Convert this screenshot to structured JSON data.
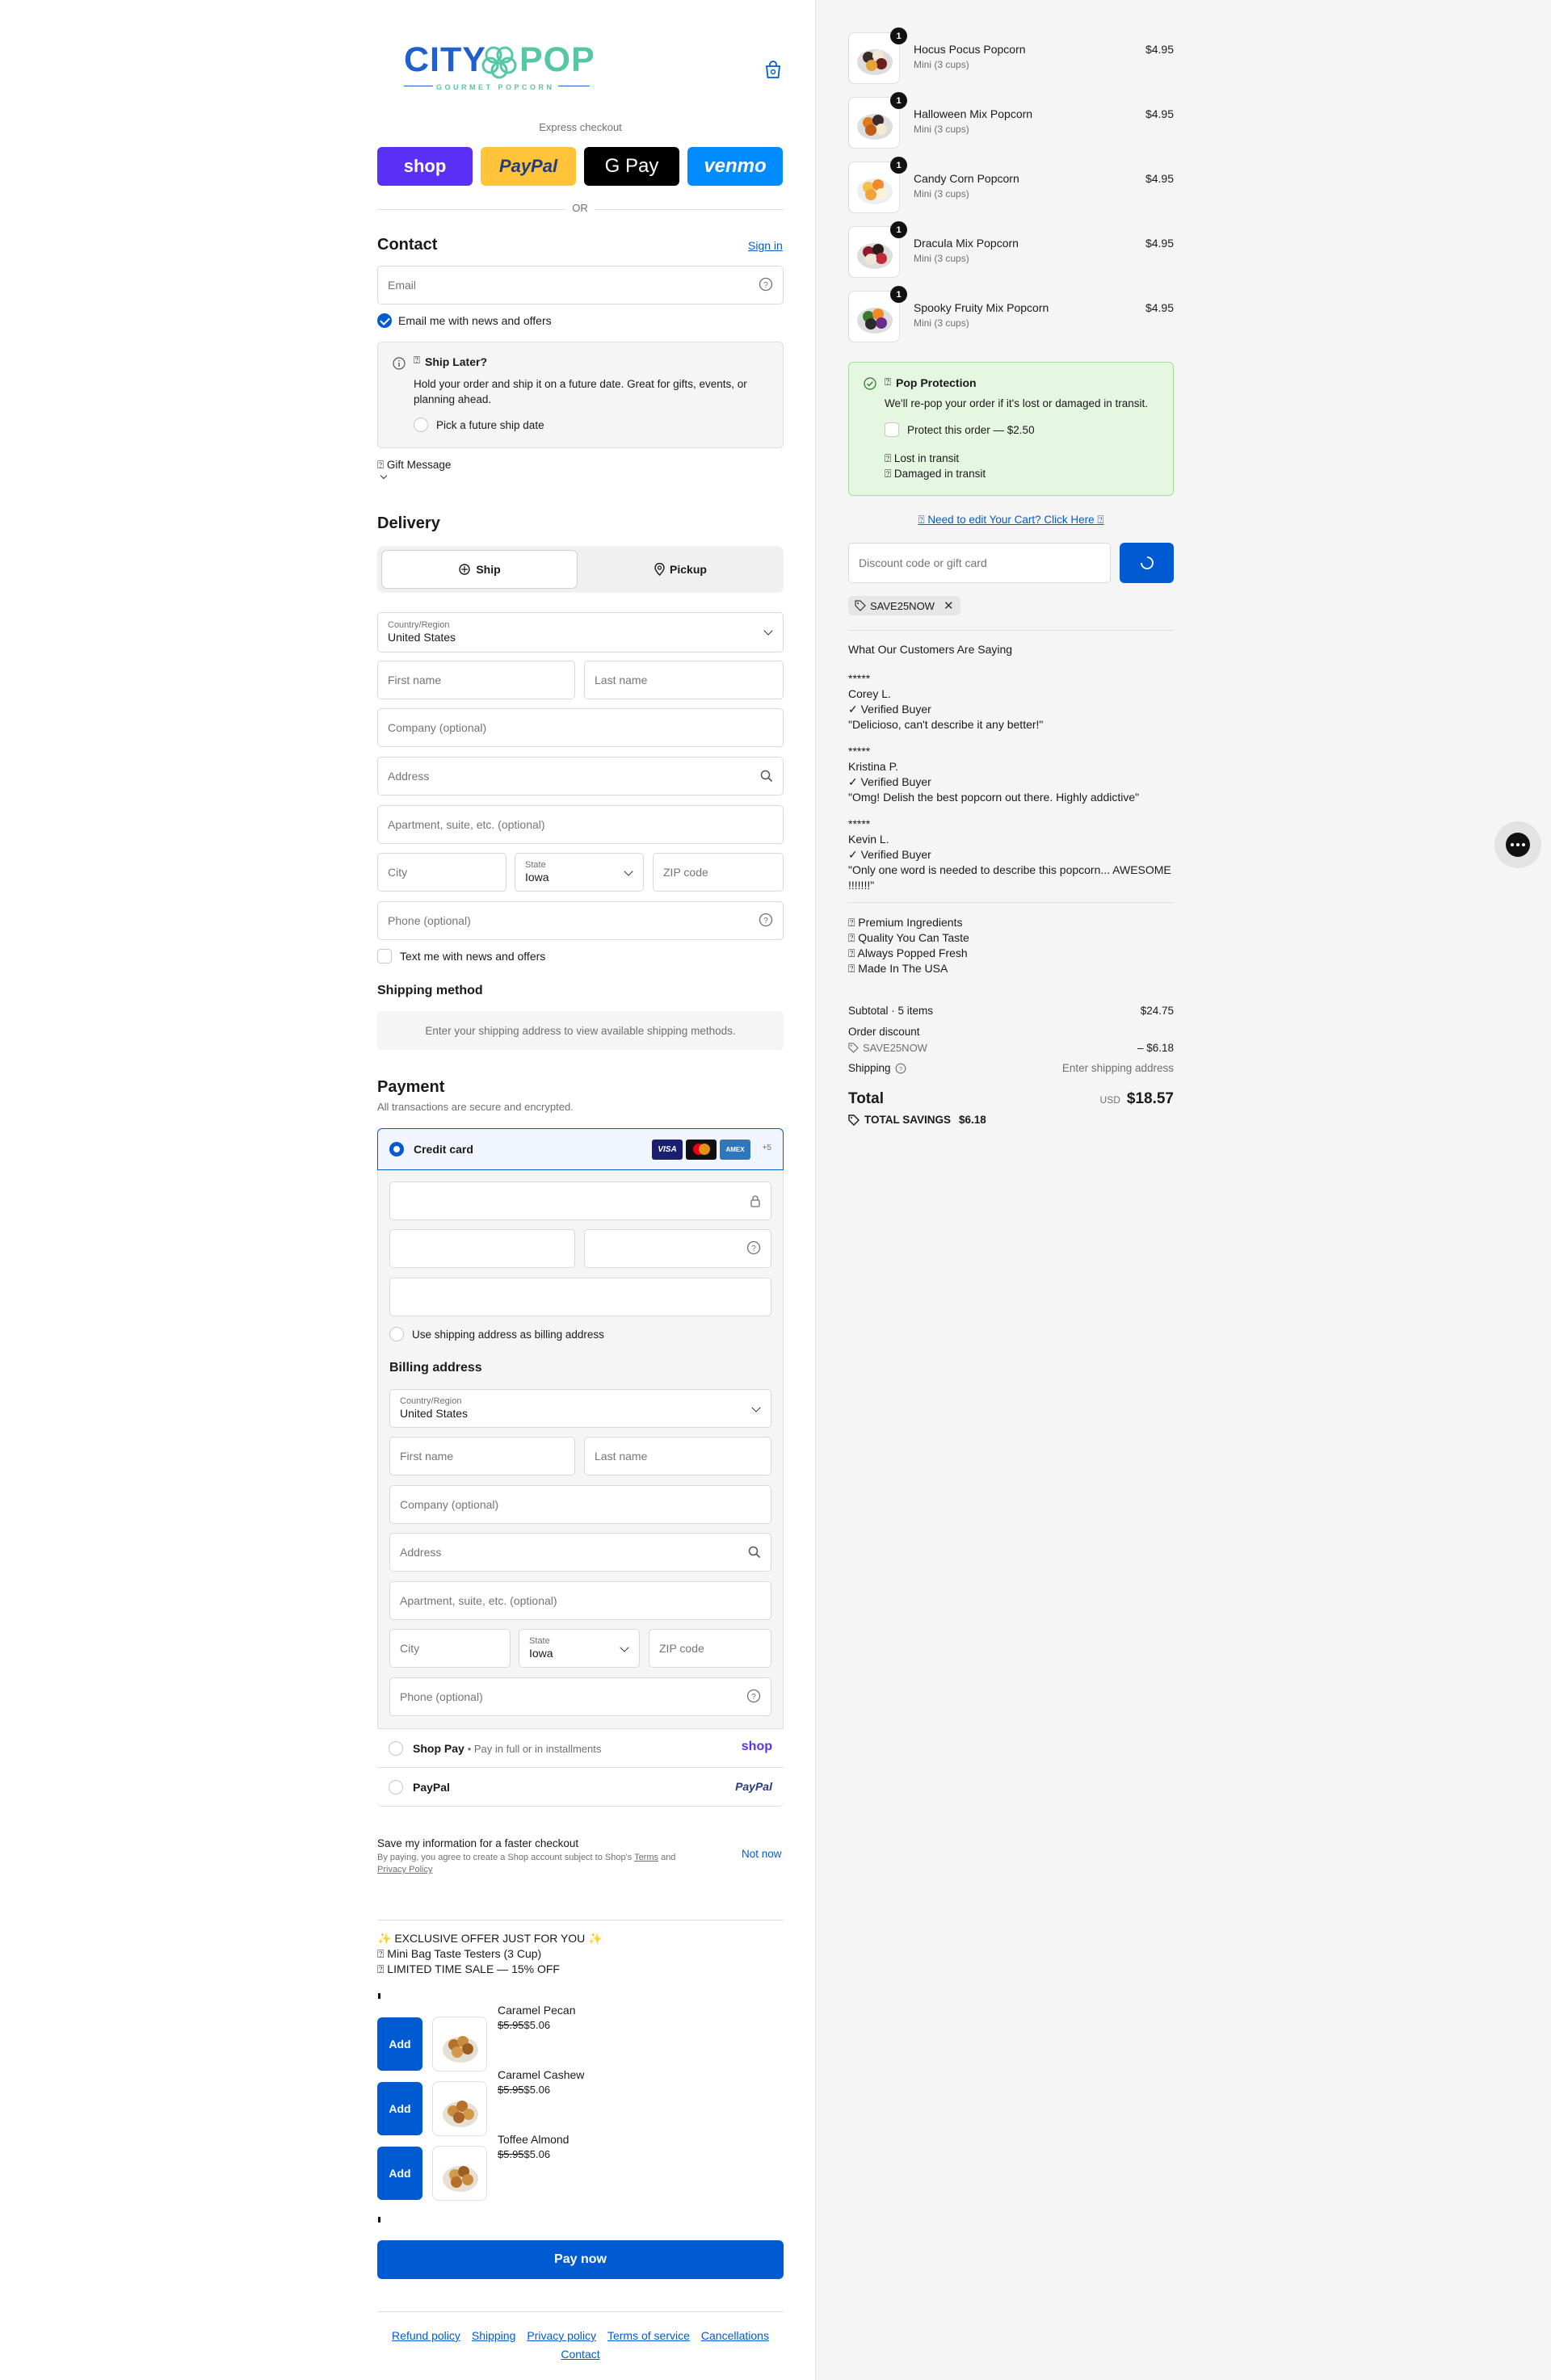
{
  "brand": {
    "name_left": "CITY",
    "name_right": "POP",
    "tagline": "GOURMET POPCORN",
    "colors": {
      "blue": "#1f5fd0",
      "green": "#55c7a4"
    }
  },
  "cart_icon": "bag-icon",
  "express": {
    "label": "Express checkout",
    "shop": "shop",
    "paypal": "PayPal",
    "gpay": "G Pay",
    "venmo": "venmo",
    "or": "OR"
  },
  "contact": {
    "title": "Contact",
    "sign_in": "Sign in",
    "email_placeholder": "Email",
    "news_label": "Email me with news and offers"
  },
  "ship_later": {
    "title": "Ship Later?",
    "desc": "Hold your order and ship it on a future date. Great for gifts, events, or planning ahead.",
    "option": "Pick a future ship date"
  },
  "gift": {
    "label": "Gift Message"
  },
  "delivery": {
    "title": "Delivery",
    "ship_tab": "Ship",
    "pickup_tab": "Pickup",
    "country_label": "Country/Region",
    "country": "United States",
    "first": "First name",
    "last": "Last name",
    "company": "Company (optional)",
    "address": "Address",
    "apt": "Apartment, suite, etc. (optional)",
    "city": "City",
    "state_label": "State",
    "state": "Iowa",
    "zip": "ZIP code",
    "phone": "Phone (optional)",
    "text_label": "Text me with news and offers"
  },
  "shipping_method": {
    "title": "Shipping method",
    "msg": "Enter your shipping address to view available shipping methods."
  },
  "payment": {
    "title": "Payment",
    "subtitle": "All transactions are secure and encrypted.",
    "credit_card": "Credit card",
    "more_cards": "+5",
    "use_shipping": "Use shipping address as billing address",
    "billing_title": "Billing address",
    "shop_pay": "Shop Pay",
    "shop_pay_desc": "Pay in full or in installments",
    "shop_logo": "shop",
    "paypal": "PayPal",
    "paypal_logo": "PayPal"
  },
  "save_info": {
    "title": "Save my information for a faster checkout",
    "desc_a": "By paying, you agree to create a Shop account subject to Shop's ",
    "terms": "Terms",
    "and": " and",
    "privacy": "Privacy Policy",
    "not_now": "Not now"
  },
  "offer": {
    "line1": "✨ EXCLUSIVE OFFER JUST FOR YOU ✨",
    "line2": "Mini Bag Taste Testers (3 Cup)",
    "line3": "LIMITED TIME SALE — 15% OFF",
    "add": "Add",
    "items": [
      {
        "name": "Caramel Pecan",
        "old": "$5.95",
        "new": "$5.06"
      },
      {
        "name": "Caramel Cashew",
        "old": "$5.95",
        "new": "$5.06"
      },
      {
        "name": "Toffee Almond",
        "old": "$5.95",
        "new": "$5.06"
      }
    ]
  },
  "pay_now": "Pay now",
  "footer": {
    "links": [
      "Refund policy",
      "Shipping",
      "Privacy policy",
      "Terms of service",
      "Cancellations",
      "Contact"
    ]
  },
  "cart": {
    "items": [
      {
        "name": "Hocus Pocus Popcorn",
        "variant": "Mini (3 cups)",
        "price": "$4.95",
        "qty": "1"
      },
      {
        "name": "Halloween Mix Popcorn",
        "variant": "Mini (3 cups)",
        "price": "$4.95",
        "qty": "1"
      },
      {
        "name": "Candy Corn Popcorn",
        "variant": "Mini (3 cups)",
        "price": "$4.95",
        "qty": "1"
      },
      {
        "name": "Dracula Mix Popcorn",
        "variant": "Mini (3 cups)",
        "price": "$4.95",
        "qty": "1"
      },
      {
        "name": "Spooky Fruity Mix Popcorn",
        "variant": "Mini (3 cups)",
        "price": "$4.95",
        "qty": "1"
      }
    ]
  },
  "protection": {
    "title": "Pop Protection",
    "desc": "We'll re-pop your order if it's lost or damaged in transit.",
    "option": "Protect this order — $2.50",
    "lost": "Lost in transit",
    "damaged": "Damaged in transit"
  },
  "edit_cart": "Need to edit Your Cart? Click Here",
  "discount": {
    "placeholder": "Discount code or gift card",
    "code": "SAVE25NOW"
  },
  "reviews": {
    "title": "What Our Customers Are Saying",
    "items": [
      {
        "stars": "*****",
        "name": "Corey L.",
        "verified": "✓ Verified Buyer",
        "text": "\"Delicioso, can't describe it any better!\""
      },
      {
        "stars": "*****",
        "name": "Kristina P.",
        "verified": "✓ Verified Buyer",
        "text": "\"Omg! Delish the best popcorn out there. Highly addictive\""
      },
      {
        "stars": "*****",
        "name": "Kevin L.",
        "verified": "✓ Verified Buyer",
        "text1": "\"Only one word is needed to describe this popcorn... AWESOME",
        "text2": "!!!!!!!\""
      }
    ]
  },
  "perks": [
    "Premium Ingredients",
    "Quality You Can Taste",
    "Always Popped Fresh",
    "Made In The USA"
  ],
  "summary": {
    "subtotal_label": "Subtotal · 5 items",
    "subtotal": "$24.75",
    "discount_label": "Order discount",
    "code": "SAVE25NOW",
    "discount": "– $6.18",
    "shipping_label": "Shipping",
    "shipping": "Enter shipping address",
    "total_label": "Total",
    "currency": "USD",
    "total": "$18.57",
    "savings_label": "TOTAL SAVINGS",
    "savings": "$6.18"
  }
}
